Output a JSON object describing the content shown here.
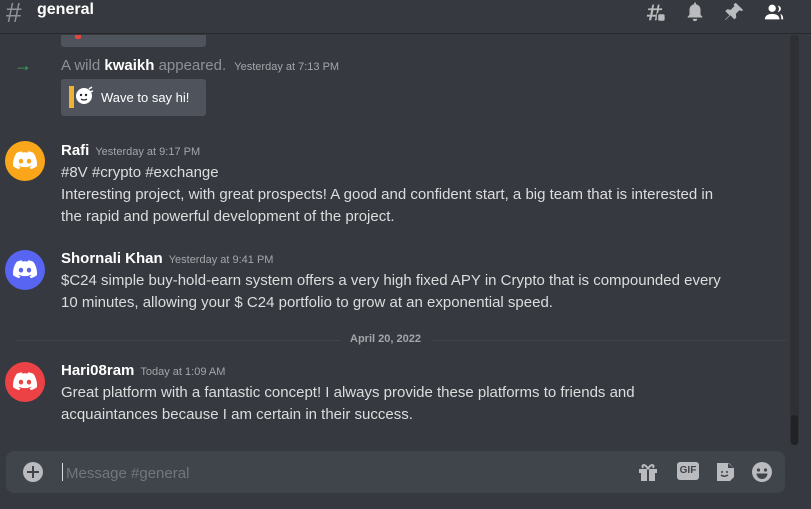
{
  "channel": {
    "hash": "#",
    "name": "general"
  },
  "header_icons": [
    "threads-icon",
    "bell-icon",
    "pin-icon",
    "members-icon"
  ],
  "join": {
    "prefix": "A wild",
    "user": "kwaikh",
    "suffix": "appeared.",
    "timestamp": "Yesterday at 7:13 PM",
    "wave_button": "Wave to say hi!"
  },
  "messages": [
    {
      "author": "Rafi",
      "timestamp": "Yesterday at 9:17 PM",
      "avatar_color": "#faa61a",
      "lines": [
        "#8V #crypto #exchange",
        "Interesting project, with great prospects! A good and confident start, a big team that is interested in",
        "the rapid and powerful development of the project."
      ]
    },
    {
      "author": "Shornali Khan",
      "timestamp": "Yesterday at 9:41 PM",
      "avatar_color": "#5865f2",
      "lines": [
        "$C24 simple buy-hold-earn system offers a very high fixed APY in Crypto that is compounded every",
        "10 minutes, allowing your $ C24 portfolio to grow at an exponential speed."
      ]
    },
    {
      "author": "Hari08ram",
      "timestamp": "Today at 1:09 AM",
      "avatar_color": "#ed4245",
      "lines": [
        "Great platform with a fantastic concept! I always provide these platforms to friends and",
        "acquaintances because I am certain in their success."
      ]
    }
  ],
  "date_divider": "April 20, 2022",
  "composer": {
    "placeholder": "Message #general",
    "gif_label": "GIF"
  },
  "colors": {
    "background": "#36393f",
    "composer": "#40444b",
    "join_arrow": "#3ba55c"
  }
}
